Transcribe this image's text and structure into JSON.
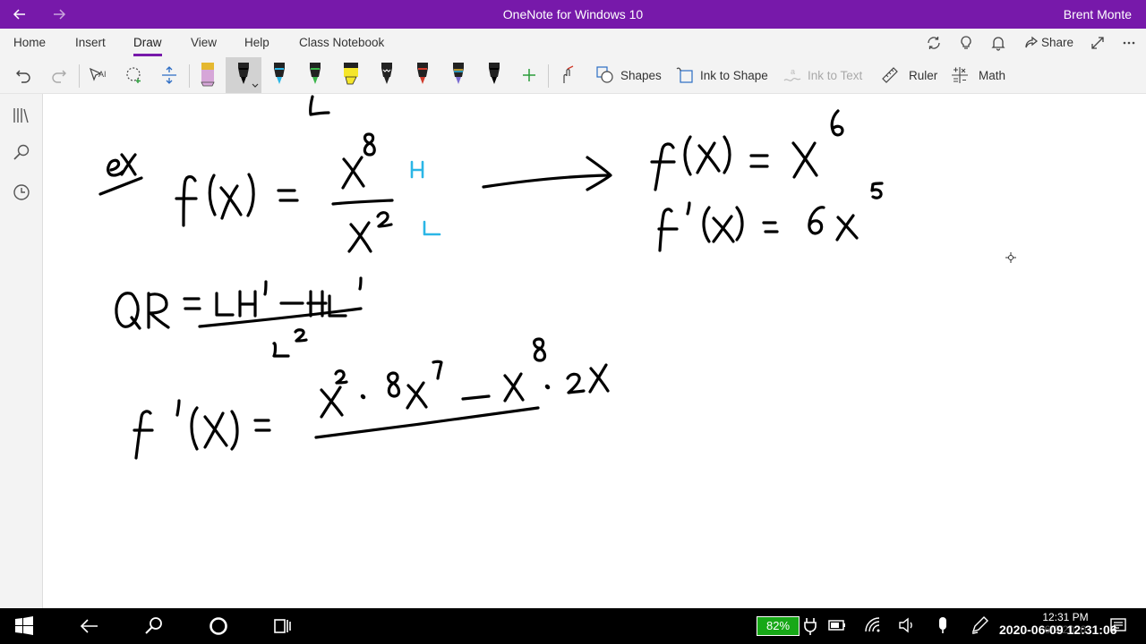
{
  "window": {
    "title": "OneNote for Windows 10",
    "user": "Brent Monte"
  },
  "menu": {
    "tabs": [
      "Home",
      "Insert",
      "Draw",
      "View",
      "Help",
      "Class Notebook"
    ],
    "active_tab": "Draw",
    "share_label": "Share"
  },
  "toolbar": {
    "shapes_label": "Shapes",
    "ink_to_shape_label": "Ink to Shape",
    "ink_to_text_label": "Ink to Text",
    "ruler_label": "Ruler",
    "math_label": "Math",
    "pens": [
      {
        "name": "pencil",
        "color": "#d6a6d8"
      },
      {
        "name": "pen-black",
        "color": "#000000"
      },
      {
        "name": "pen-cyan",
        "color": "#2bb6e6"
      },
      {
        "name": "pen-green",
        "color": "#3ab54a"
      },
      {
        "name": "highlighter-yellow",
        "color": "#f5e62a"
      },
      {
        "name": "pen-galaxy",
        "color": "#ffffff"
      },
      {
        "name": "pen-red",
        "color": "#d13b2b"
      },
      {
        "name": "pen-multicolor",
        "color": "#7a6bd1"
      },
      {
        "name": "pen-black-2",
        "color": "#000000"
      }
    ]
  },
  "taskbar": {
    "battery": "82%",
    "time": "12:31 PM",
    "date": "6/9/2020",
    "timestamp_overlay": "2020-06-09 12:31:06"
  },
  "accent_color": "#7719aa"
}
